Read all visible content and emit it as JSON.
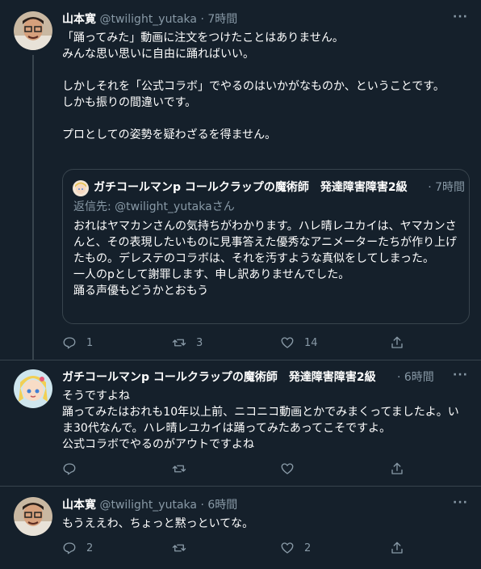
{
  "tweets": [
    {
      "name": "山本寛",
      "handle": "@twilight_yutaka",
      "time": "· 7時間",
      "more": "···",
      "text": "「踊ってみた」動画に注文をつけたことはありません。\nみんな思い思いに自由に踊ればいい。\n\nしかしそれを「公式コラボ」でやるのはいかがなものか、ということです。\nしかも振りの間違いです。\n\nプロとしての姿勢を疑わざるを得ません。",
      "quote": {
        "name": "ガチコールマンp コールクラップの魔術師　発達障害障害2級",
        "time": "· 7時間",
        "reply_prefix": "返信先: ",
        "reply_mention": "@twilight_yutakaさん",
        "text": "おれはヤマカンさんの気持ちがわかります。ハレ晴レユカイは、ヤマカンさんと、その表現したいものに見事答えた優秀なアニメーターたちが作り上げたもの。デレステのコラボは、それを汚すような真似をしてしまった。\n一人のpとして謝罪します、申し訳ありませんでした。\n踊る声優もどうかとおもう"
      },
      "replies": "1",
      "retweets": "3",
      "likes": "14",
      "share": ""
    },
    {
      "name": "ガチコールマンp コールクラップの魔術師　発達障害障害2級",
      "time": "· 6時間",
      "more": "···",
      "text": "そうですよね\n踊ってみたはおれも10年以上前、ニコニコ動画とかでみまくってましたよ。いま30代なんで。ハレ晴レユカイは踊ってみたあってこそですよ。\n公式コラボでやるのがアウトですよね",
      "replies": "",
      "retweets": "",
      "likes": "",
      "share": ""
    },
    {
      "name": "山本寛",
      "handle": "@twilight_yutaka",
      "time": "· 6時間",
      "more": "···",
      "text": "もうええわ、ちょっと黙っといてな。",
      "replies": "2",
      "retweets": "",
      "likes": "2",
      "share": ""
    }
  ],
  "colors": {
    "background": "#15202b",
    "muted": "#8899a6",
    "border": "#38444d"
  }
}
